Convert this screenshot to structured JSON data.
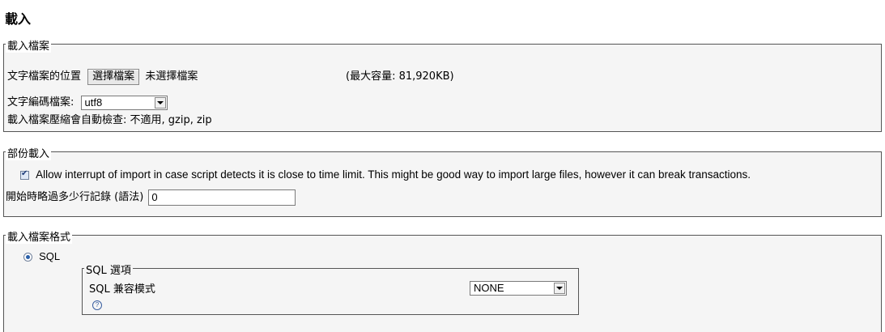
{
  "page": {
    "title": "載入"
  },
  "file_section": {
    "legend": "載入檔案",
    "location_label": "文字檔案的位置",
    "choose_button": "選擇檔案",
    "no_file_text": "未選擇檔案",
    "max_size": "(最大容量: 81,920KB)",
    "charset_label": "文字編碼檔案:",
    "charset_value": "utf8",
    "compression_text": "載入檔案壓縮會自動檢查: 不適用, gzip, zip"
  },
  "partial_section": {
    "legend": "部份載入",
    "allow_interrupt_checked": true,
    "allow_interrupt_label": "Allow interrupt of import in case script detects it is close to time limit. This might be good way to import large files, however it can break transactions.",
    "skip_label": "開始時略過多少行記錄 (語法)",
    "skip_value": "0"
  },
  "format_section": {
    "legend": "載入檔案格式",
    "sql_radio_label": "SQL",
    "sql_radio_checked": true,
    "sql_options": {
      "legend": "SQL 選項",
      "compat_label": "SQL 兼容模式",
      "compat_value": "NONE",
      "help_icon": "help-icon"
    }
  }
}
